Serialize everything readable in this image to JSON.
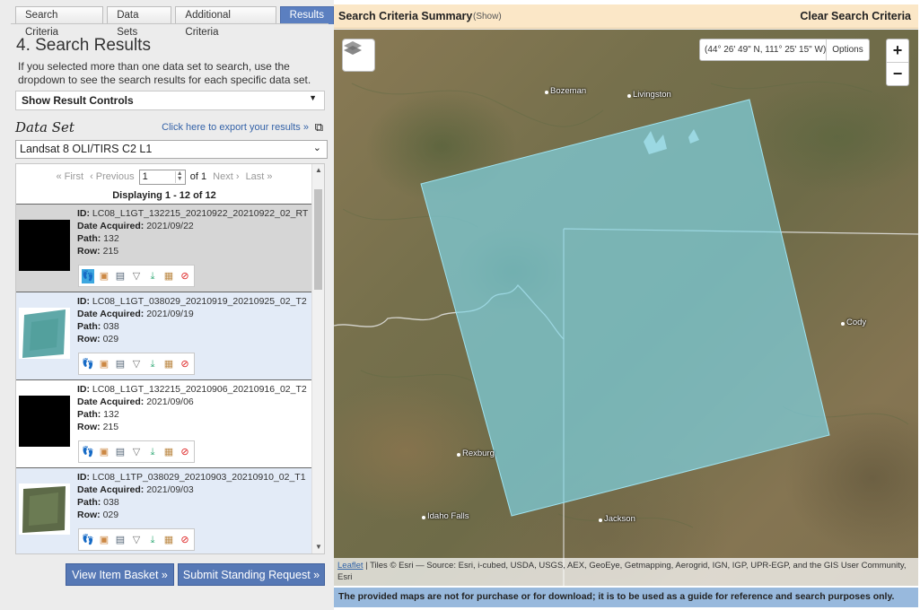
{
  "tabs": [
    "Search Criteria",
    "Data Sets",
    "Additional Criteria",
    "Results"
  ],
  "section_title": "4. Search Results",
  "intro": "If you selected more than one data set to search, use the dropdown to see the search results for each specific data set.",
  "result_controls": "Show Result Controls",
  "dataset_label": "Data Set",
  "export_link": "Click here to export your results »",
  "dataset_selected": "Landsat 8 OLI/TIRS C2 L1",
  "pager": {
    "first": "« First",
    "previous": "‹ Previous",
    "page_value": "1",
    "of": "of 1",
    "next": "Next ›",
    "last": "Last »",
    "displaying": "Displaying 1 - 12 of 12"
  },
  "labels": {
    "id": "ID:",
    "date_acquired": "Date Acquired:",
    "path": "Path:",
    "row": "Row:"
  },
  "results": [
    {
      "id": "LC08_L1GT_132215_20210922_20210922_02_RT",
      "date": "2021/09/22",
      "path": "132",
      "row": "215"
    },
    {
      "id": "LC08_L1GT_038029_20210919_20210925_02_T2",
      "date": "2021/09/19",
      "path": "038",
      "row": "029"
    },
    {
      "id": "LC08_L1GT_132215_20210906_20210916_02_T2",
      "date": "2021/09/06",
      "path": "132",
      "row": "215"
    },
    {
      "id": "LC08_L1TP_038029_20210903_20210910_02_T1",
      "date": "2021/09/03",
      "path": "038",
      "row": "029"
    }
  ],
  "buttons": {
    "basket": "View Item Basket »",
    "standing": "Submit Standing Request »"
  },
  "map": {
    "header_title": "Search Criteria Summary",
    "header_show": "(Show)",
    "clear": "Clear Search Criteria",
    "coordinates": "(44° 26' 49\" N, 111° 25' 15\" W)",
    "options": "Options",
    "zoom_in": "+",
    "zoom_out": "−",
    "cities": [
      "Bozeman",
      "Livingston",
      "Cody",
      "Rexburg",
      "Idaho Falls",
      "Jackson"
    ],
    "attribution_link": "Leaflet",
    "attribution_text": " | Tiles © Esri — Source: Esri, i-cubed, USDA, USGS, AEX, GeoEye, Getmapping, Aerogrid, IGN, IGP, UPR-EGP, and the GIS User Community, Esri",
    "footprint_color": "#7fd6e8"
  },
  "disclaimer": "The provided maps are not for purchase or for download; it is to be used as a guide for reference and search purposes only."
}
